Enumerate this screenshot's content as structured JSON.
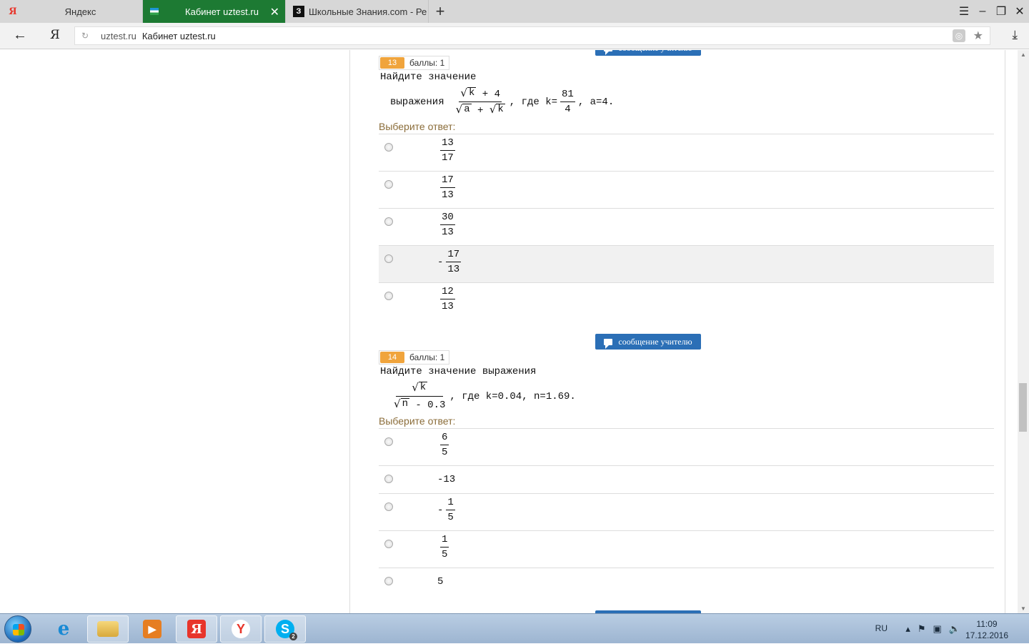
{
  "browser": {
    "tabs": [
      {
        "label": "Яндекс",
        "icon": "yandex-icon",
        "active": false
      },
      {
        "label": "Кабинет uztest.ru",
        "icon": "uztest-favicon",
        "active": true
      },
      {
        "label": "Школьные Знания.com - Ре",
        "icon": "znanija-favicon",
        "active": false
      }
    ],
    "new_tab": "+",
    "url_host": "uztest.ru",
    "url_title": "Кабинет uztest.ru"
  },
  "page": {
    "message_button_label": "сообщение учителю",
    "choose_label": "Выберите ответ:",
    "questions": [
      {
        "number": "13",
        "score": "баллы: 1",
        "text_line1": "Найдите значение",
        "text_prefix": "выражения",
        "expr": {
          "num_sqrt": "k",
          "num_rest": "+ 4",
          "den_sqrt1": "a",
          "den_plus": "+",
          "den_sqrt2": "k"
        },
        "condition": {
          "where": ", где k=",
          "k_num": "81",
          "k_den": "4",
          "rest": ", a=4."
        },
        "answers": [
          {
            "sign": "",
            "num": "13",
            "den": "17"
          },
          {
            "sign": "",
            "num": "17",
            "den": "13"
          },
          {
            "sign": "",
            "num": "30",
            "den": "13"
          },
          {
            "sign": "-",
            "num": "17",
            "den": "13",
            "highlighted": true
          },
          {
            "sign": "",
            "num": "12",
            "den": "13"
          }
        ]
      },
      {
        "number": "14",
        "score": "баллы: 1",
        "text_line1": "Найдите значение выражения",
        "expr": {
          "num_sqrt": "k",
          "den_sqrt": "n",
          "den_rest": "- 0.3"
        },
        "condition": ", где k=0.04, n=1.69.",
        "answers": [
          {
            "sign": "",
            "num": "6",
            "den": "5"
          },
          {
            "plain": "-13"
          },
          {
            "sign": "-",
            "num": "1",
            "den": "5"
          },
          {
            "sign": "",
            "num": "1",
            "den": "5"
          },
          {
            "plain": "5"
          }
        ]
      }
    ]
  },
  "taskbar": {
    "apps": [
      "internet-explorer-icon",
      "file-explorer-icon",
      "media-player-icon",
      "yandex-browser-icon",
      "yandex-icon",
      "skype-icon"
    ],
    "skype_badge": "2",
    "lang": "RU",
    "time": "11:09",
    "date": "17.12.2016"
  }
}
